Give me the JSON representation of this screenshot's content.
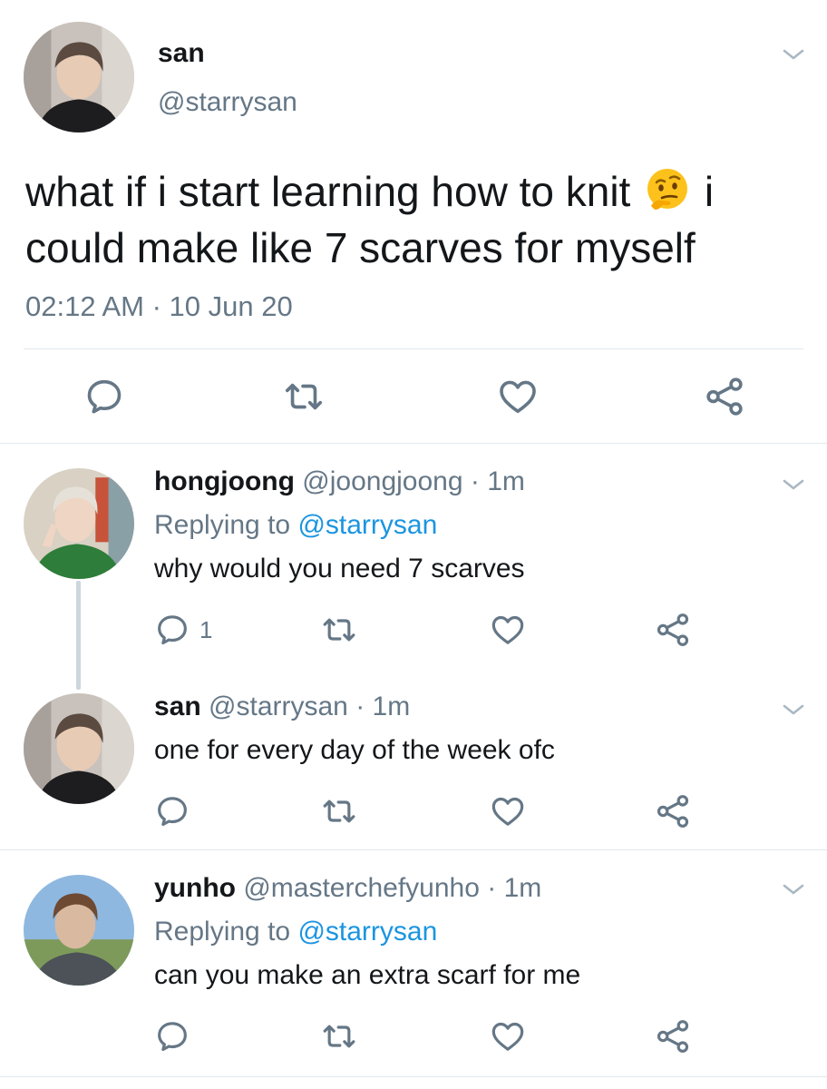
{
  "colors": {
    "text": "#14171a",
    "secondary": "#657786",
    "link": "#1b95e0",
    "divider": "#e1e8ed",
    "thread_line": "#ccd6dd"
  },
  "main_tweet": {
    "display_name": "san",
    "handle": "@starrysan",
    "text_part1": "what if i start learning how to knit",
    "text_emoji": "thinking-face-emoji",
    "text_part2": " i",
    "text_line2": "could make like 7 scarves for myself",
    "timestamp": "02:12 AM · 10 Jun 20",
    "actions": [
      "reply-icon",
      "retweet-icon",
      "like-icon",
      "share-icon"
    ]
  },
  "replies": [
    {
      "display_name": "hongjoong",
      "handle": "@joongjoong",
      "time": "· 1m",
      "replying_prefix": "Replying to ",
      "replying_handle": "@starrysan",
      "text": "why would you need 7 scarves",
      "reply_count": "1"
    },
    {
      "display_name": "san",
      "handle": "@starrysan",
      "time": "· 1m",
      "text": "one for every day of the week ofc"
    },
    {
      "display_name": "yunho",
      "handle": "@masterchefyunho",
      "time": "· 1m",
      "replying_prefix": "Replying to ",
      "replying_handle": "@starrysan",
      "text": "can you make an extra scarf for me"
    }
  ]
}
